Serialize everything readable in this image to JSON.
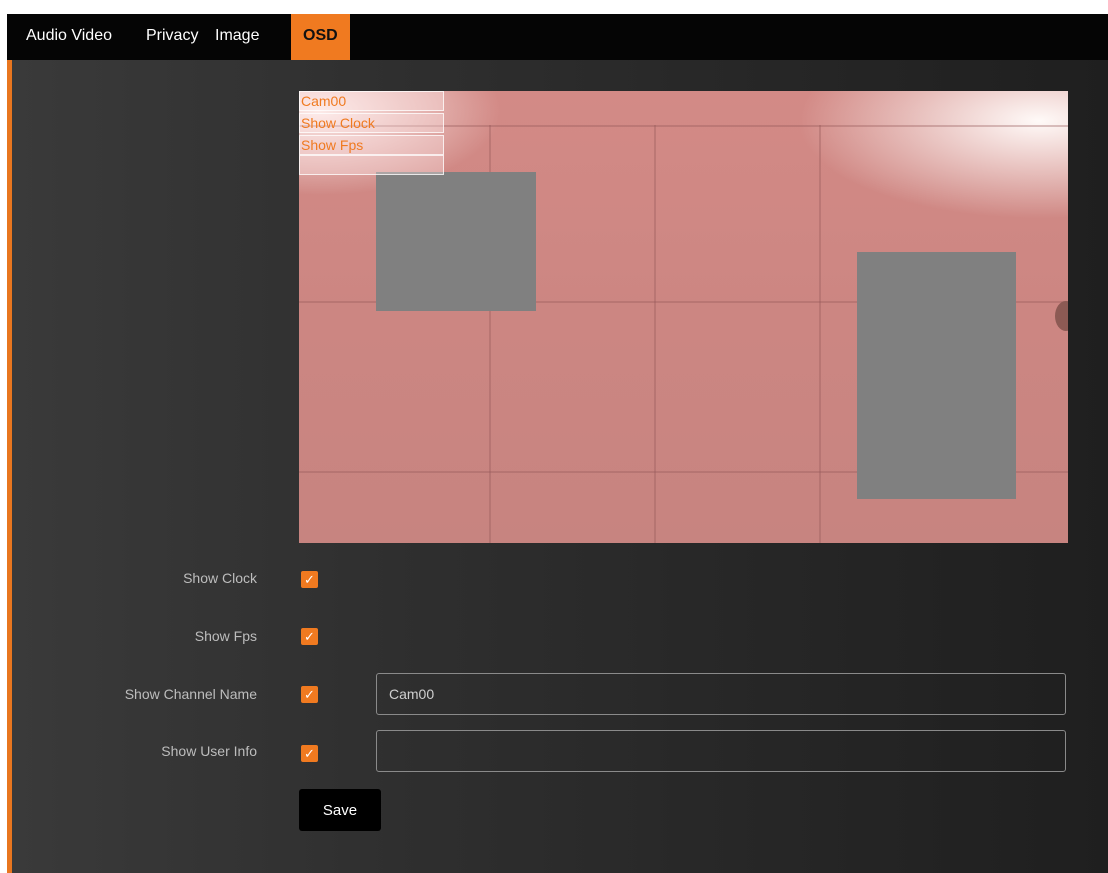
{
  "tabs": [
    {
      "label": "Audio Video",
      "active": false
    },
    {
      "label": "Privacy",
      "active": false
    },
    {
      "label": "Image",
      "active": false
    },
    {
      "label": "OSD",
      "active": true
    }
  ],
  "preview": {
    "osd_overlays": [
      "Cam00",
      "Show Clock",
      "Show Fps",
      ""
    ],
    "overlay_text_color": "#f07a20",
    "privacy_mask_color": "#808080"
  },
  "settings": {
    "show_clock": {
      "label": "Show Clock",
      "checked": true
    },
    "show_fps": {
      "label": "Show Fps",
      "checked": true
    },
    "show_channel_name": {
      "label": "Show Channel Name",
      "checked": true,
      "value": "Cam00"
    },
    "show_user_info": {
      "label": "Show User Info",
      "checked": true,
      "value": ""
    }
  },
  "actions": {
    "save_label": "Save"
  },
  "colors": {
    "accent": "#f07a20",
    "topbar": "#050505",
    "background": "#2a2a2a"
  },
  "icons": {
    "checkbox": "check-icon"
  }
}
